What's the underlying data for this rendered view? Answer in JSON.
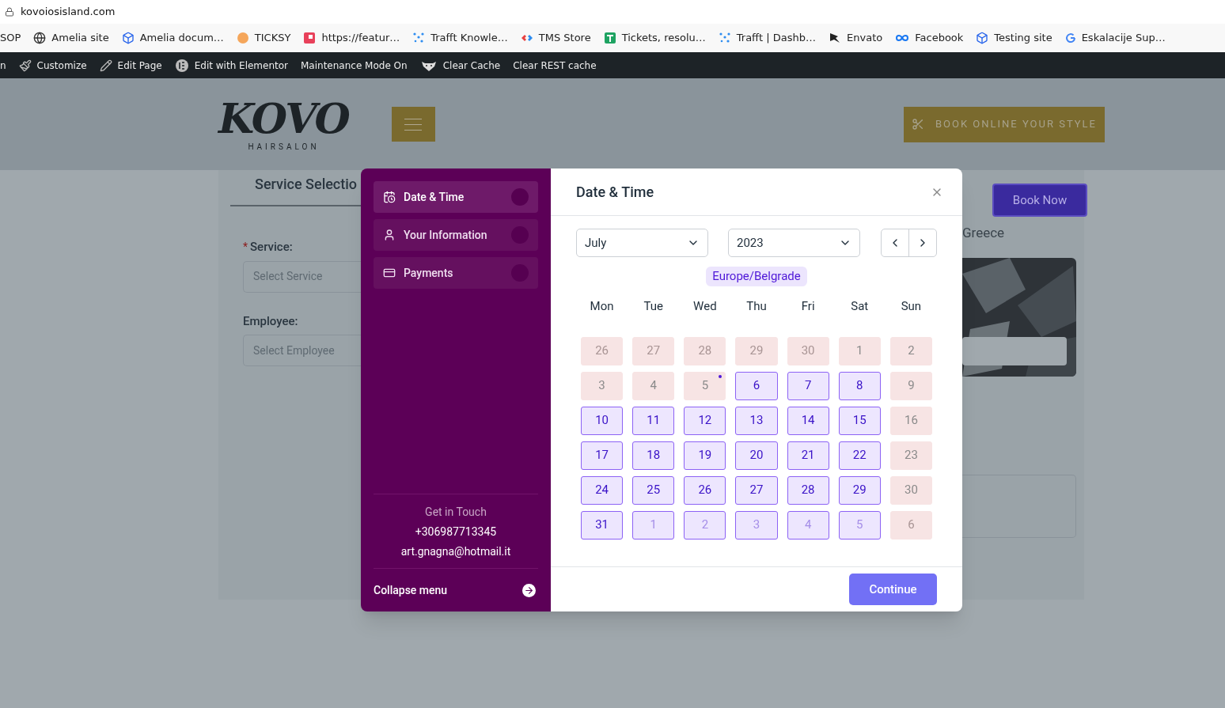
{
  "browser": {
    "url": "kovoiosisland.com",
    "bookmarks": [
      "SOP",
      "Amelia site",
      "Amelia docum…",
      "TICKSY",
      "https://featur…",
      "Trafft Knowle…",
      "TMS Store",
      "Tickets, resolu…",
      "Trafft | Dashb…",
      "Envato",
      "Facebook",
      "Testing site",
      "Eskalacije Sup…"
    ]
  },
  "admin_bar": [
    "n",
    "Customize",
    "Edit Page",
    "Edit with Elementor",
    "Maintenance Mode On",
    "Clear Cache",
    "Clear REST cache"
  ],
  "header": {
    "logo": "KOVO",
    "logo_sub": "HAIRSALON",
    "cta": "BOOK ONLINE YOUR STYLE"
  },
  "form": {
    "title": "Service Selectio",
    "service_label": "Service:",
    "required_mark": "*",
    "service_placeholder": "Select Service",
    "employee_label": "Employee:",
    "employee_placeholder": "Select Employee",
    "book_now": "Book Now",
    "location": "Greece"
  },
  "modal": {
    "steps": [
      {
        "label": "Date & Time",
        "selected": true
      },
      {
        "label": "Your Information",
        "selected": false
      },
      {
        "label": "Payments",
        "selected": false
      }
    ],
    "contact": {
      "title": "Get in Touch",
      "phone": "+306987713345",
      "email": "art.gnagna@hotmail.it"
    },
    "collapse": "Collapse menu",
    "title": "Date & Time",
    "month": "July",
    "year": "2023",
    "timezone": "Europe/Belgrade",
    "weekdays": [
      "Mon",
      "Tue",
      "Wed",
      "Thu",
      "Fri",
      "Sat",
      "Sun"
    ],
    "days": [
      {
        "label": "26",
        "available": false,
        "outside": true,
        "today": false
      },
      {
        "label": "27",
        "available": false,
        "outside": true,
        "today": false
      },
      {
        "label": "28",
        "available": false,
        "outside": true,
        "today": false
      },
      {
        "label": "29",
        "available": false,
        "outside": true,
        "today": false
      },
      {
        "label": "30",
        "available": false,
        "outside": true,
        "today": false
      },
      {
        "label": "1",
        "available": false,
        "outside": false,
        "today": false
      },
      {
        "label": "2",
        "available": false,
        "outside": false,
        "today": false
      },
      {
        "label": "3",
        "available": false,
        "outside": false,
        "today": false
      },
      {
        "label": "4",
        "available": false,
        "outside": false,
        "today": false
      },
      {
        "label": "5",
        "available": false,
        "outside": false,
        "today": true
      },
      {
        "label": "6",
        "available": true,
        "outside": false,
        "today": false
      },
      {
        "label": "7",
        "available": true,
        "outside": false,
        "today": false
      },
      {
        "label": "8",
        "available": true,
        "outside": false,
        "today": false
      },
      {
        "label": "9",
        "available": false,
        "outside": false,
        "today": false
      },
      {
        "label": "10",
        "available": true,
        "outside": false,
        "today": false
      },
      {
        "label": "11",
        "available": true,
        "outside": false,
        "today": false
      },
      {
        "label": "12",
        "available": true,
        "outside": false,
        "today": false
      },
      {
        "label": "13",
        "available": true,
        "outside": false,
        "today": false
      },
      {
        "label": "14",
        "available": true,
        "outside": false,
        "today": false
      },
      {
        "label": "15",
        "available": true,
        "outside": false,
        "today": false
      },
      {
        "label": "16",
        "available": false,
        "outside": false,
        "today": false
      },
      {
        "label": "17",
        "available": true,
        "outside": false,
        "today": false
      },
      {
        "label": "18",
        "available": true,
        "outside": false,
        "today": false
      },
      {
        "label": "19",
        "available": true,
        "outside": false,
        "today": false
      },
      {
        "label": "20",
        "available": true,
        "outside": false,
        "today": false
      },
      {
        "label": "21",
        "available": true,
        "outside": false,
        "today": false
      },
      {
        "label": "22",
        "available": true,
        "outside": false,
        "today": false
      },
      {
        "label": "23",
        "available": false,
        "outside": false,
        "today": false
      },
      {
        "label": "24",
        "available": true,
        "outside": false,
        "today": false
      },
      {
        "label": "25",
        "available": true,
        "outside": false,
        "today": false
      },
      {
        "label": "26",
        "available": true,
        "outside": false,
        "today": false
      },
      {
        "label": "27",
        "available": true,
        "outside": false,
        "today": false
      },
      {
        "label": "28",
        "available": true,
        "outside": false,
        "today": false
      },
      {
        "label": "29",
        "available": true,
        "outside": false,
        "today": false
      },
      {
        "label": "30",
        "available": false,
        "outside": false,
        "today": false
      },
      {
        "label": "31",
        "available": true,
        "outside": false,
        "today": false
      },
      {
        "label": "1",
        "available": true,
        "outside": true,
        "today": false
      },
      {
        "label": "2",
        "available": true,
        "outside": true,
        "today": false
      },
      {
        "label": "3",
        "available": true,
        "outside": true,
        "today": false
      },
      {
        "label": "4",
        "available": true,
        "outside": true,
        "today": false
      },
      {
        "label": "5",
        "available": true,
        "outside": true,
        "today": false
      },
      {
        "label": "6",
        "available": false,
        "outside": true,
        "today": false
      }
    ],
    "continue": "Continue"
  }
}
